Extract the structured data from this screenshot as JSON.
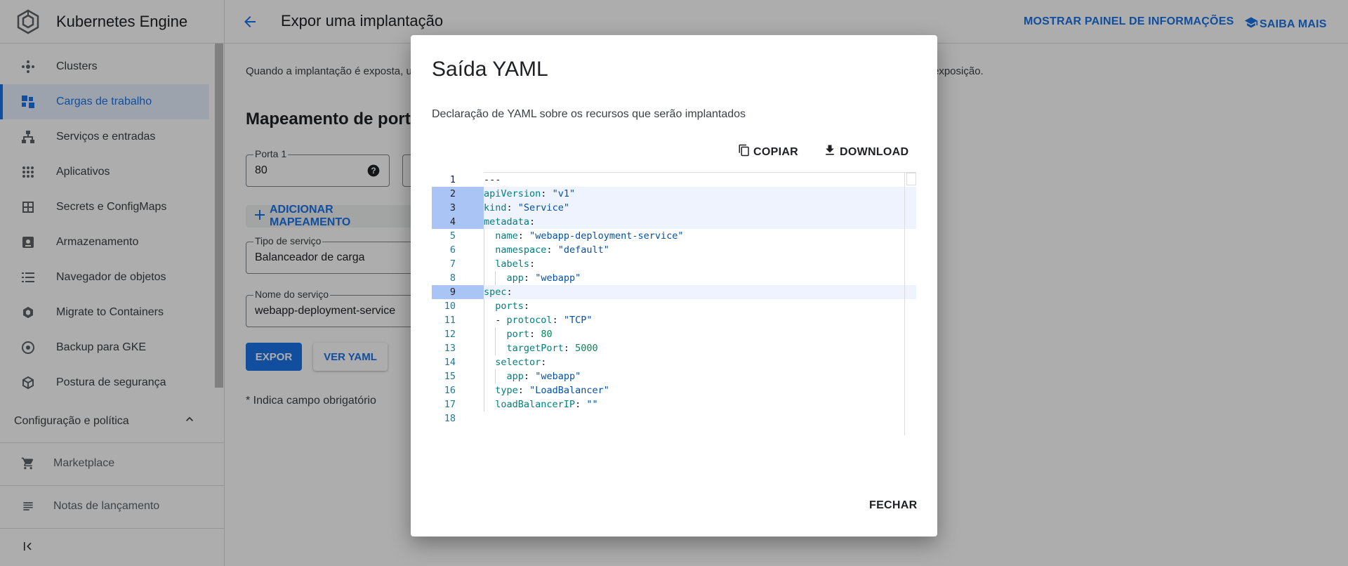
{
  "app": {
    "title": "Kubernetes Engine"
  },
  "header": {
    "page_title": "Expor uma implantação",
    "info_panel": "MOSTRAR PAINEL DE INFORMAÇÕES",
    "learn_more": "SAIBA MAIS"
  },
  "sidebar": {
    "items": [
      {
        "label": "Clusters",
        "icon": "clusters-icon"
      },
      {
        "label": "Cargas de trabalho",
        "icon": "workloads-icon",
        "active": true
      },
      {
        "label": "Serviços e entradas",
        "icon": "services-icon"
      },
      {
        "label": "Aplicativos",
        "icon": "apps-icon"
      },
      {
        "label": "Secrets e ConfigMaps",
        "icon": "secrets-icon"
      },
      {
        "label": "Armazenamento",
        "icon": "storage-icon"
      },
      {
        "label": "Navegador de objetos",
        "icon": "object-browser-icon"
      },
      {
        "label": "Migrate to Containers",
        "icon": "migrate-icon"
      },
      {
        "label": "Backup para GKE",
        "icon": "backup-icon"
      },
      {
        "label": "Postura de segurança",
        "icon": "security-icon"
      }
    ],
    "section": "Configuração e política",
    "marketplace": "Marketplace",
    "release_notes": "Notas de lançamento"
  },
  "main": {
    "intro": "Quando a implantação é exposta, u",
    "intro_tail": "exposição.",
    "section_title": "Mapeamento de port",
    "port_label": "Porta 1",
    "port_value": "80",
    "add_mapping": "ADICIONAR MAPEAMENTO",
    "service_type_label": "Tipo de serviço",
    "service_type_value": "Balanceador de carga",
    "service_name_label": "Nome do serviço",
    "service_name_value": "webapp-deployment-service",
    "expose_button": "EXPOR",
    "view_yaml_button": "VER YAML",
    "required_note": "* Indica campo obrigatório"
  },
  "dialog": {
    "title": "Saída YAML",
    "description": "Declaração de YAML sobre os recursos que serão implantados",
    "copy": "COPIAR",
    "download": "DOWNLOAD",
    "close": "FECHAR",
    "code_lines": [
      "---",
      "apiVersion: \"v1\"",
      "kind: \"Service\"",
      "metadata:",
      "  name: \"webapp-deployment-service\"",
      "  namespace: \"default\"",
      "  labels:",
      "    app: \"webapp\"",
      "spec:",
      "  ports:",
      "  - protocol: \"TCP\"",
      "    port: 80",
      "    targetPort: 5000",
      "  selector:",
      "    app: \"webapp\"",
      "  type: \"LoadBalancer\"",
      "  loadBalancerIP: \"\"",
      ""
    ]
  }
}
